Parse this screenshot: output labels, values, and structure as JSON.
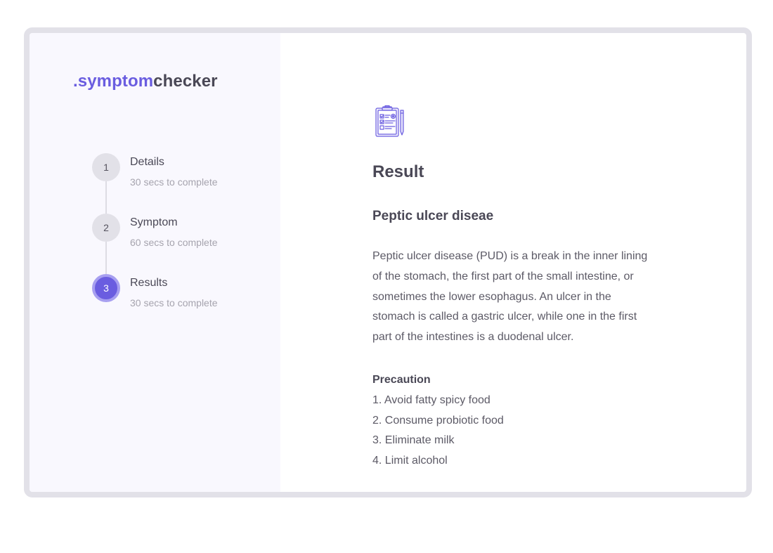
{
  "logo": {
    "dot": ".",
    "brand": "symptom",
    "rest": "checker"
  },
  "steps": [
    {
      "number": "1",
      "title": "Details",
      "subtitle": "30 secs to complete",
      "active": false
    },
    {
      "number": "2",
      "title": "Symptom",
      "subtitle": "60 secs to complete",
      "active": false
    },
    {
      "number": "3",
      "title": "Results",
      "subtitle": "30 secs to complete",
      "active": true
    }
  ],
  "result": {
    "icon": "clipboard-checklist-icon",
    "heading": "Result",
    "disease": "Peptic ulcer diseae",
    "description": "Peptic ulcer disease (PUD) is a break in the inner lining of the stomach, the first part of the small intestine, or sometimes the lower esophagus. An ulcer in the stomach is called a gastric ulcer, while one in the first part of the intestines is a duodenal ulcer.",
    "precaution_title": "Precaution",
    "precautions": [
      "1. Avoid fatty spicy food",
      "2. Consume probiotic food",
      "3. Eliminate milk",
      "4. Limit alcohol"
    ]
  },
  "colors": {
    "accent": "#6a5de0",
    "accent_ring": "#a79ff0",
    "text_dark": "#4a4856",
    "text_muted": "#a6a4ae",
    "sidebar_bg": "#f9f8fe",
    "frame_border": "#e2e1e8"
  }
}
